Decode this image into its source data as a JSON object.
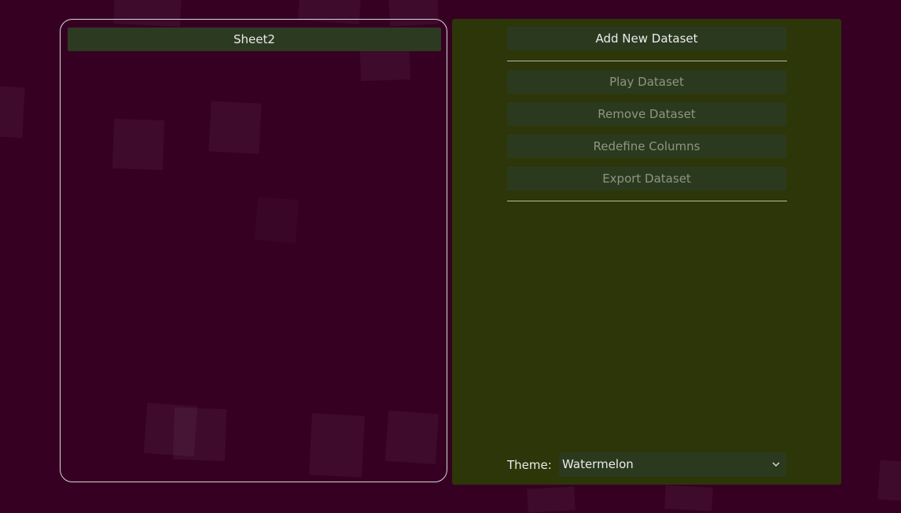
{
  "datasets": {
    "items": [
      {
        "label": "Sheet2"
      }
    ]
  },
  "actions": {
    "add_label": "Add New Dataset",
    "play_label": "Play Dataset",
    "remove_label": "Remove Dataset",
    "redefine_label": "Redefine Columns",
    "export_label": "Export Dataset"
  },
  "theme": {
    "label": "Theme:",
    "selected": "Watermelon"
  },
  "icons": {
    "theme_dropdown": "chevron-down-icon"
  },
  "colors": {
    "background": "#360023",
    "panel": "#2c3608",
    "button": "#2b3a1f",
    "text": "#ececec",
    "disabled_text": "#8f9680"
  }
}
